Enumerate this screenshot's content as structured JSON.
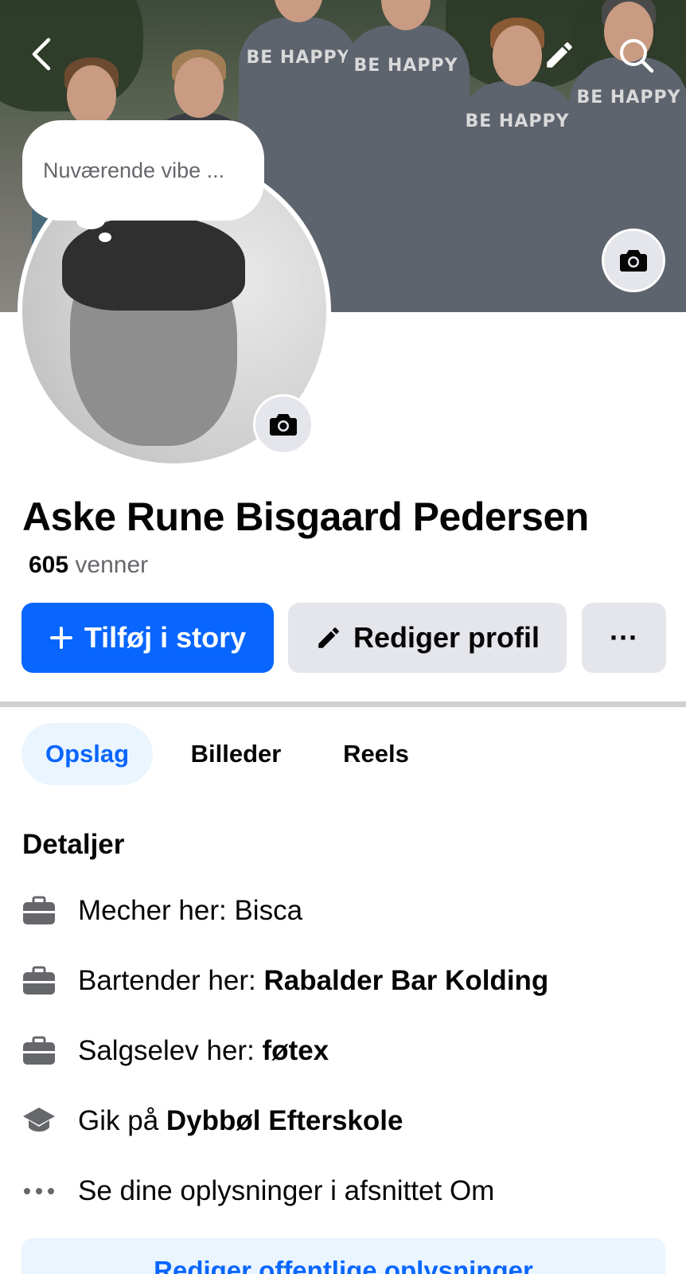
{
  "cover": {
    "shirt_text": "BE HAPPY"
  },
  "vibe": {
    "placeholder": "Nuværende vibe ..."
  },
  "profile": {
    "name": "Aske Rune Bisgaard Pedersen",
    "friends_count": "605",
    "friends_label": "venner"
  },
  "actions": {
    "story_label": "Tilføj i story",
    "edit_label": "Rediger profil",
    "more_label": "···"
  },
  "tabs": [
    {
      "label": "Opslag",
      "active": true
    },
    {
      "label": "Billeder",
      "active": false
    },
    {
      "label": "Reels",
      "active": false
    }
  ],
  "details": {
    "title": "Detaljer",
    "items": [
      {
        "icon": "briefcase-icon",
        "prefix": "Mecher her: Bisca",
        "bold": ""
      },
      {
        "icon": "briefcase-icon",
        "prefix": "Bartender her: ",
        "bold": "Rabalder Bar Kolding"
      },
      {
        "icon": "briefcase-icon",
        "prefix": "Salgselev her: ",
        "bold": "føtex"
      },
      {
        "icon": "graduation-cap-icon",
        "prefix": "Gik på ",
        "bold": "Dybbøl Efterskole"
      },
      {
        "icon": "more-dots-icon",
        "prefix": "Se dine oplysninger i afsnittet Om",
        "bold": ""
      }
    ],
    "edit_public_label": "Rediger offentlige oplysninger"
  },
  "colors": {
    "accent": "#0866ff",
    "button_gray": "#e4e6eb",
    "secondary_text": "#65676b",
    "tab_active_bg": "#ebf5ff"
  }
}
